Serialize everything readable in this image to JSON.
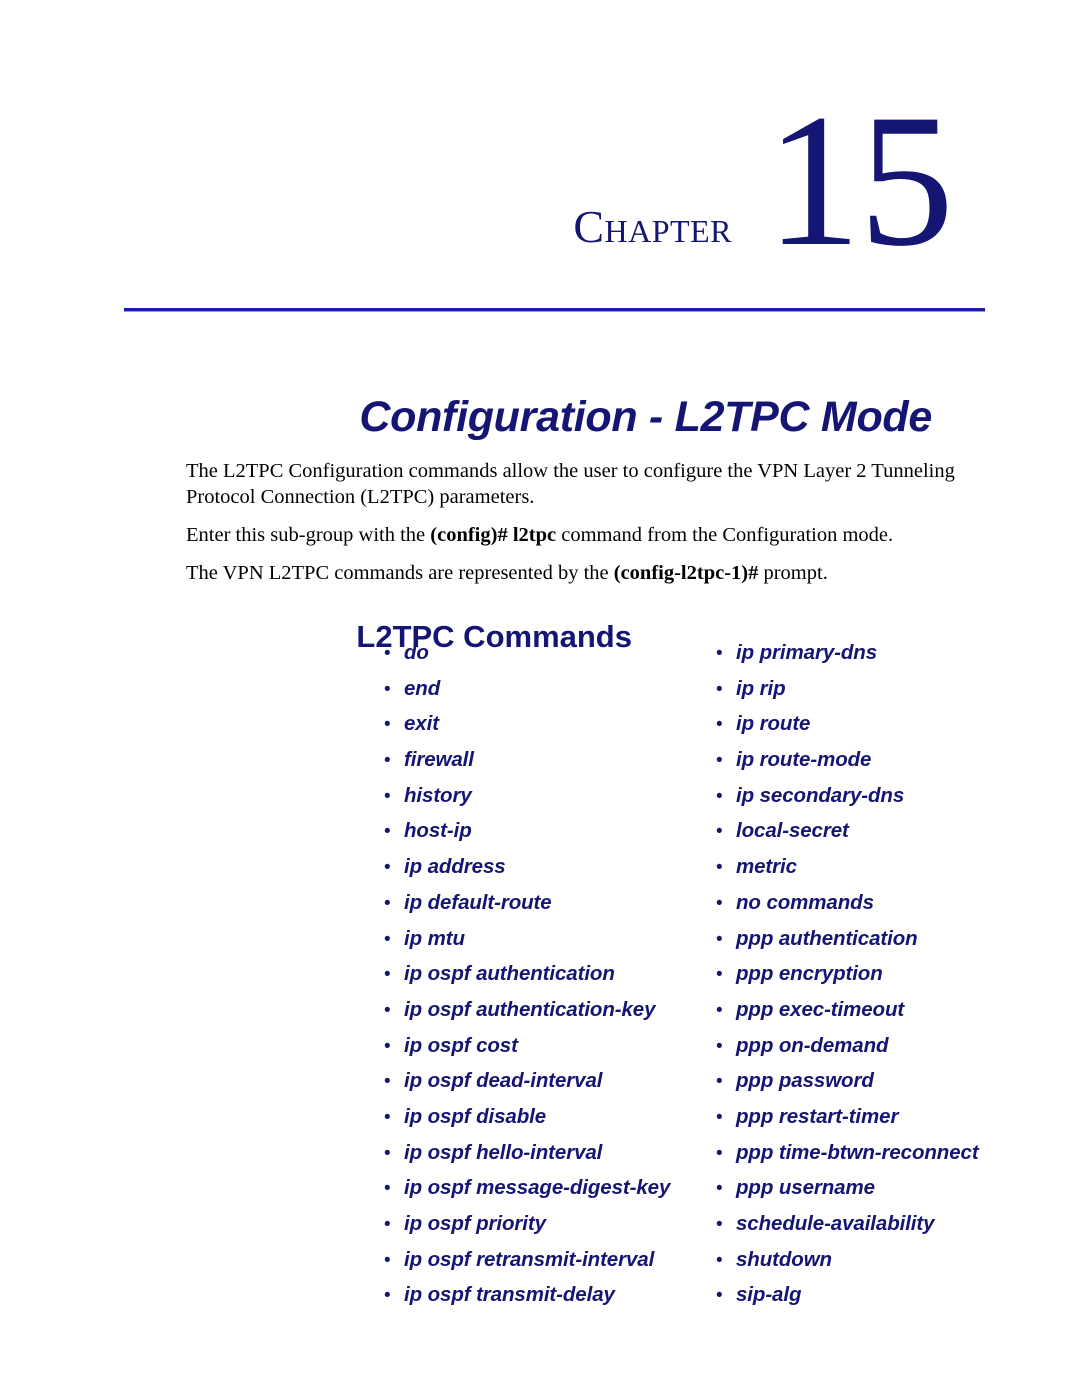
{
  "chapter": {
    "word": "Chapter",
    "number": "15"
  },
  "title": "Configuration - L2TPC Mode",
  "intro": {
    "p1_part1": "The L2TPC Configuration commands allow the user to configure the VPN Layer 2 Tunneling Protocol Connection (L2TPC) parameters.",
    "p2_part1": "Enter this sub-group with the ",
    "p2_bold": "(config)# l2tpc",
    "p2_part2": " command from the Configuration mode.",
    "p3_part1": "The VPN L2TPC commands are represented by the ",
    "p3_bold": "(config-l2tpc-1)#",
    "p3_part2": " prompt."
  },
  "section_heading": "L2TPC  Commands",
  "bullet_glyph": "•",
  "colors": {
    "navy": "#151573",
    "rule_blue": "#1a1aa8",
    "body_text": "#000000"
  },
  "commands": {
    "left": [
      "do",
      "end",
      "exit",
      "firewall",
      "history",
      "host-ip",
      "ip address",
      "ip default-route",
      "ip mtu",
      "ip ospf authentication",
      "ip ospf authentication-key",
      "ip ospf cost",
      "ip ospf dead-interval",
      "ip ospf disable",
      "ip ospf hello-interval",
      "ip ospf message-digest-key",
      "ip ospf priority",
      "ip ospf retransmit-interval",
      "ip ospf transmit-delay"
    ],
    "right": [
      "ip primary-dns",
      "ip rip",
      "ip route",
      "ip route-mode",
      "ip secondary-dns",
      "local-secret",
      "metric",
      "no commands",
      "ppp authentication",
      "ppp encryption",
      "ppp exec-timeout",
      "ppp on-demand",
      "ppp password",
      "ppp restart-timer",
      "ppp time-btwn-reconnect",
      "ppp username",
      "schedule-availability",
      "shutdown",
      "sip-alg"
    ]
  }
}
